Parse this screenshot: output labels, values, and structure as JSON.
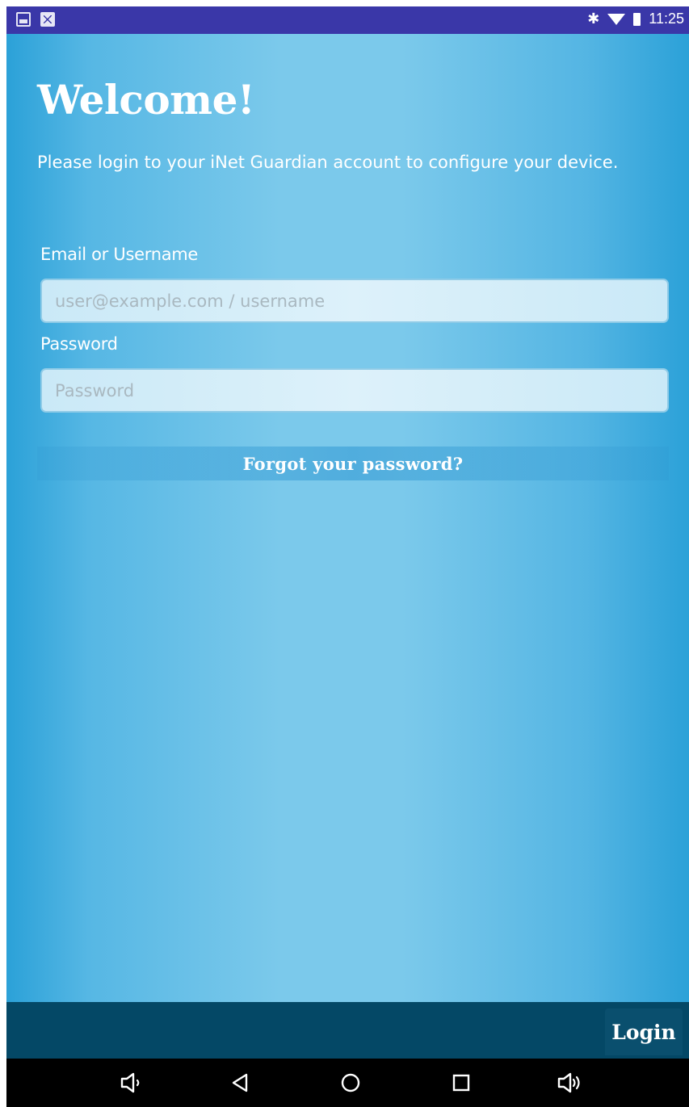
{
  "status_bar": {
    "time": "11:25",
    "left_icons": [
      "image-icon",
      "gmail-icon"
    ],
    "right_icons": [
      "bluetooth-icon",
      "wifi-icon",
      "battery-icon"
    ]
  },
  "main": {
    "title": "Welcome!",
    "subtitle": "Please login to your iNet Guardian account to configure your device.",
    "email_label": "Email or Username",
    "email_placeholder": "user@example.com / username",
    "email_value": "",
    "password_label": "Password",
    "password_placeholder": "Password",
    "password_value": "",
    "forgot_link": "Forgot your password?"
  },
  "footer": {
    "login_label": "Login"
  },
  "nav_bar": {
    "items": [
      "volume-down-icon",
      "back-icon",
      "home-icon",
      "recents-icon",
      "volume-up-icon"
    ]
  },
  "colors": {
    "status_bar": "#3a37a8",
    "background_edge": "#2ba1d8",
    "background_center": "#7bc9eb",
    "footer": "#044866",
    "nav_bar": "#000000"
  }
}
